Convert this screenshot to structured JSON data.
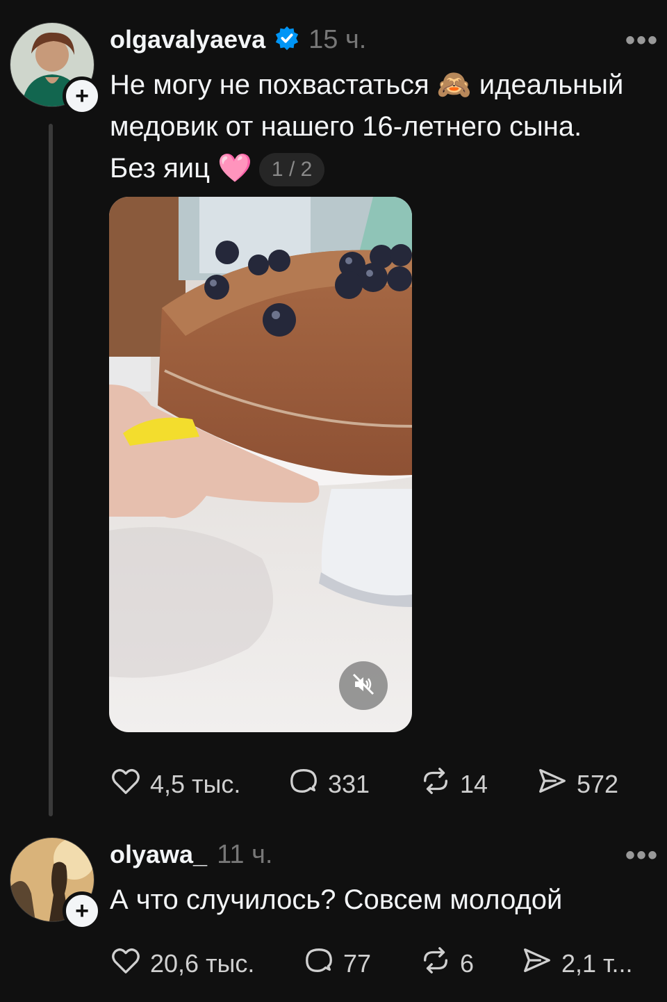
{
  "post": {
    "username": "olgavalyaeva",
    "verified": true,
    "time": "15 ч.",
    "more_label": "•••",
    "text_line1": "Не могу не похвастаться",
    "emoji1": "🙈",
    "text_line1b": "идеальный",
    "text_line2": "медовик от нашего 16-летнего сына.",
    "text_line3": "Без яиц",
    "emoji2": "🩷",
    "media_counter": "1 / 2",
    "actions": {
      "likes": "4,5 тыс.",
      "replies": "331",
      "reposts": "14",
      "shares": "572"
    }
  },
  "reply": {
    "username": "olyawa_",
    "time": "11 ч.",
    "more_label": "•••",
    "text": "А что случилось? Совсем молодой",
    "actions": {
      "likes": "20,6 тыс.",
      "replies": "77",
      "reposts": "6",
      "shares": "2,1 т..."
    }
  },
  "colors": {
    "background": "#101010",
    "text": "#f3f5f7",
    "muted": "#777777",
    "verified": "#0095f6"
  },
  "icons": {
    "like": "heart-icon",
    "reply": "comment-bubble-icon",
    "repost": "repost-icon",
    "share": "send-icon",
    "mute": "speaker-muted-icon",
    "follow": "plus-icon",
    "verified": "verified-badge-icon"
  }
}
